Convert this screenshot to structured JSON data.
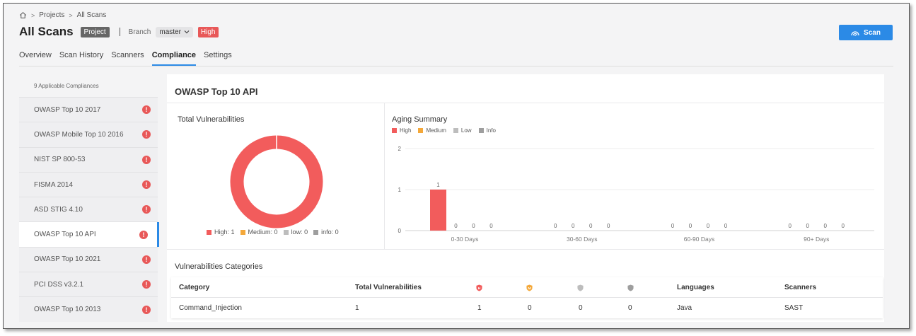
{
  "breadcrumb": {
    "items": [
      "Projects",
      "All Scans"
    ]
  },
  "header": {
    "title": "All Scans",
    "project_badge": "Project",
    "branch_label": "Branch",
    "branch_value": "master",
    "severity_badge": "High",
    "scan_button": "Scan"
  },
  "tabs": [
    "Overview",
    "Scan History",
    "Scanners",
    "Compliance",
    "Settings"
  ],
  "active_tab": "Compliance",
  "sidebar": {
    "heading": "9 Applicable Compliances",
    "items": [
      "OWASP Top 10 2017",
      "OWASP Mobile Top 10 2016",
      "NIST SP 800-53",
      "FISMA 2014",
      "ASD STIG 4.10",
      "OWASP Top 10 API",
      "OWASP Top 10 2021",
      "PCI DSS v3.2.1",
      "OWASP Top 10 2013"
    ],
    "active_index": 5
  },
  "main": {
    "title": "OWASP Top 10 API",
    "total_vuln_title": "Total Vulnerabilities",
    "aging_title": "Aging Summary",
    "categories_title": "Vulnerabilities Categories"
  },
  "colors": {
    "high": "#f25c5c",
    "medium": "#f4a83a",
    "low": "#bdbdbd",
    "info": "#9e9e9e",
    "accent": "#2b8ae6"
  },
  "chart_data": [
    {
      "type": "pie",
      "title": "Total Vulnerabilities",
      "style": "donut",
      "slices": [
        {
          "label": "High",
          "value": 1
        },
        {
          "label": "Medium",
          "value": 0
        },
        {
          "label": "low",
          "value": 0
        },
        {
          "label": "info",
          "value": 0
        }
      ],
      "legend_labels": [
        "High: 1",
        "Medium: 0",
        "low: 0",
        "info: 0"
      ],
      "legend": "bottom"
    },
    {
      "type": "bar",
      "title": "Aging Summary",
      "categories": [
        "0-30 Days",
        "30-60 Days",
        "60-90 Days",
        "90+ Days"
      ],
      "series": [
        {
          "name": "High",
          "values": [
            1,
            0,
            0,
            0
          ]
        },
        {
          "name": "Medium",
          "values": [
            0,
            0,
            0,
            0
          ]
        },
        {
          "name": "Low",
          "values": [
            0,
            0,
            0,
            0
          ]
        },
        {
          "name": "Info",
          "values": [
            0,
            0,
            0,
            0
          ]
        }
      ],
      "yticks": [
        "0",
        "1",
        "2"
      ],
      "ylim": [
        0,
        2
      ],
      "grid": true,
      "legend": "top-left",
      "data_labels": true
    }
  ],
  "table": {
    "columns": [
      "Category",
      "Total Vulnerabilities",
      "high-shield-icon",
      "medium-shield-icon",
      "low-shield-icon",
      "info-shield-icon",
      "Languages",
      "Scanners"
    ],
    "headers": {
      "category": "Category",
      "total": "Total Vulnerabilities",
      "languages": "Languages",
      "scanners": "Scanners"
    },
    "rows": [
      {
        "category": "Command_Injection",
        "total": "1",
        "high": "1",
        "medium": "0",
        "low": "0",
        "info": "0",
        "languages": "Java",
        "scanners": "SAST"
      }
    ]
  }
}
